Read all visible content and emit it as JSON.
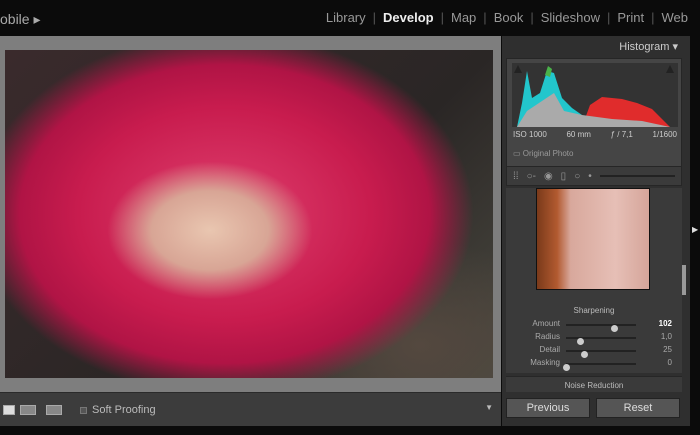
{
  "topbar": {
    "brand": "obile ▸",
    "modules": [
      "Library",
      "Develop",
      "Map",
      "Book",
      "Slideshow",
      "Print",
      "Web"
    ],
    "active": "Develop"
  },
  "histogram": {
    "title": "Histogram ▾",
    "iso": "ISO 1000",
    "focal": "60 mm",
    "aperture": "ƒ / 7,1",
    "shutter": "1/1600",
    "original_photo": "Original Photo"
  },
  "detail": {
    "section": "Sharpening",
    "sliders": [
      {
        "label": "Amount",
        "value": "102",
        "fraction": 0.68
      },
      {
        "label": "Radius",
        "value": "1,0",
        "fraction": 0.2
      },
      {
        "label": "Detail",
        "value": "25",
        "fraction": 0.25
      },
      {
        "label": "Masking",
        "value": "0",
        "fraction": 0.0
      }
    ],
    "next_section": "Noise Reduction"
  },
  "buttons": {
    "previous": "Previous",
    "reset": "Reset"
  },
  "toolbar": {
    "soft_proofing": "Soft Proofing"
  },
  "colors": {
    "accent": "#e6e6e6",
    "panel": "#2f2f2f",
    "canvas": "#7e7e7e"
  }
}
